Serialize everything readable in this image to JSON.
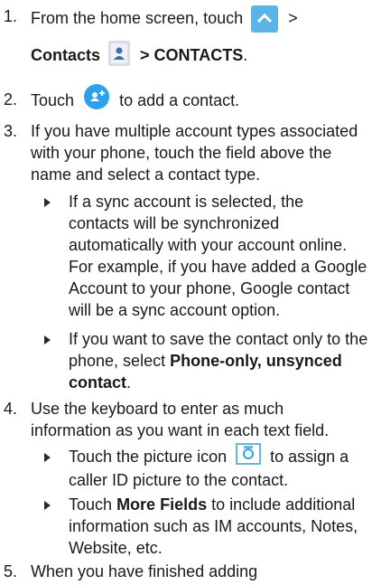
{
  "steps": [
    {
      "number": "1.",
      "line1_prefix": "From the home screen, touch",
      "line1_suffix": ">",
      "line2_bold": "Contacts",
      "line2_bold_after": "> CONTACTS",
      "line2_end": ".",
      "icons": [
        "up-arrow-icon",
        "contacts-icon"
      ]
    },
    {
      "number": "2.",
      "prefix": "Touch",
      "suffix": "to add a contact.",
      "icons": [
        "add-contact-icon"
      ]
    },
    {
      "number": "3.",
      "text": "If you have multiple account types associated with your phone, touch the field above the name and select a contact type.",
      "bullets": [
        {
          "text": "If a sync account is selected, the contacts will be synchronized automatically with your account online. For example, if you have added a Google Account to your phone, Google contact will be a sync account option."
        },
        {
          "prefix": "If you want to save the contact only to the phone, select",
          "bold": "Phone-only, unsynced contact",
          "suffix": "."
        }
      ]
    },
    {
      "number": "4.",
      "text": "Use the keyboard to enter as much information as you want in each text field.",
      "bullets": [
        {
          "prefix": "Touch the picture icon",
          "suffix": "to assign a caller ID picture to the contact.",
          "icons": [
            "camera-icon"
          ]
        },
        {
          "prefix": "Touch",
          "bold": "More Fields",
          "suffix": "to include additional information such as IM accounts, Notes, Website, etc."
        }
      ]
    },
    {
      "number": "5.",
      "text": "When you have finished adding"
    }
  ],
  "colors": {
    "text": "#1a1a1a",
    "home_icon_bg": "#5ab4e6",
    "add_icon_bg": "#2aa3ea",
    "contacts_icon_bg": "#d7dde6"
  }
}
